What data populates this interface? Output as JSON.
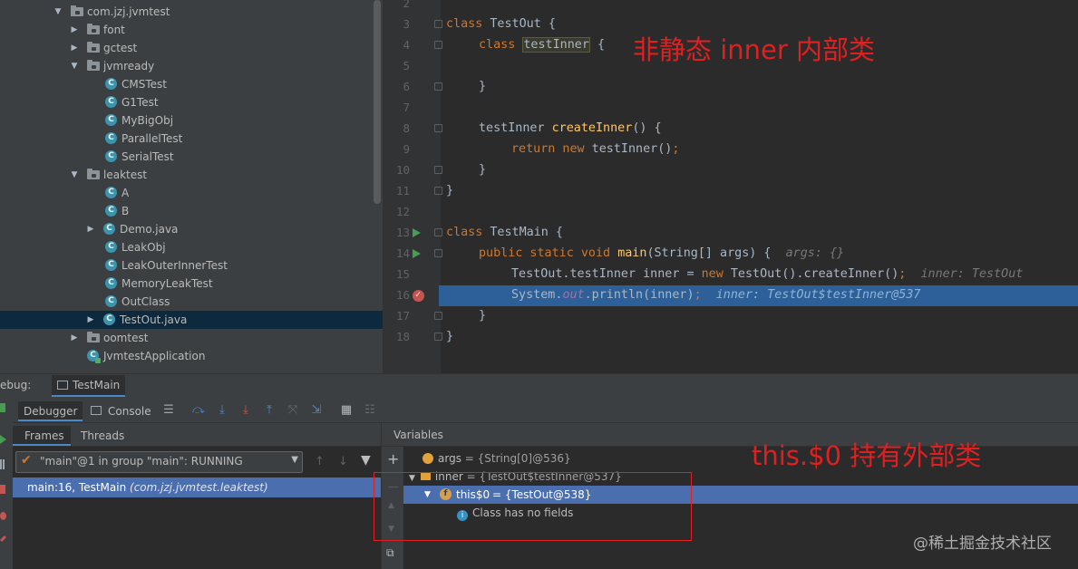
{
  "project_tree": {
    "items": [
      {
        "label": "com.jzj.jvmtest",
        "kind": "package",
        "expanded": true,
        "depth": 0
      },
      {
        "label": "font",
        "kind": "package",
        "expanded": false,
        "depth": 1
      },
      {
        "label": "gctest",
        "kind": "package",
        "expanded": false,
        "depth": 1
      },
      {
        "label": "jvmready",
        "kind": "package",
        "expanded": true,
        "depth": 1
      },
      {
        "label": "CMSTest",
        "kind": "class",
        "depth": 2
      },
      {
        "label": "G1Test",
        "kind": "class",
        "depth": 2
      },
      {
        "label": "MyBigObj",
        "kind": "class",
        "depth": 2
      },
      {
        "label": "ParallelTest",
        "kind": "class",
        "depth": 2
      },
      {
        "label": "SerialTest",
        "kind": "class",
        "depth": 2
      },
      {
        "label": "leaktest",
        "kind": "package",
        "expanded": true,
        "depth": 1
      },
      {
        "label": "A",
        "kind": "class",
        "depth": 2
      },
      {
        "label": "B",
        "kind": "class",
        "depth": 2
      },
      {
        "label": "Demo.java",
        "kind": "file",
        "depth": 2
      },
      {
        "label": "LeakObj",
        "kind": "class",
        "depth": 2
      },
      {
        "label": "LeakOuterInnerTest",
        "kind": "class",
        "depth": 2
      },
      {
        "label": "MemoryLeakTest",
        "kind": "class",
        "depth": 2
      },
      {
        "label": "OutClass",
        "kind": "class",
        "depth": 2
      },
      {
        "label": "TestOut.java",
        "kind": "file",
        "depth": 2,
        "selected": true
      },
      {
        "label": "oomtest",
        "kind": "package",
        "expanded": false,
        "depth": 1
      },
      {
        "label": "JvmtestApplication",
        "kind": "app",
        "depth": 1
      }
    ]
  },
  "editor": {
    "line_numbers": [
      "2",
      "3",
      "4",
      "5",
      "6",
      "7",
      "8",
      "9",
      "10",
      "11",
      "12",
      "13",
      "14",
      "15",
      "16",
      "17",
      "18"
    ],
    "code": {
      "l3_kw": "class",
      "l3_name": " TestOut {",
      "l4_kw": "class",
      "l4_name": "testInner",
      "l4_rest": " {",
      "l6": "}",
      "l8_type": "testInner ",
      "l8_fn": "createInner",
      "l8_rest": "() {",
      "l9_kw": "return new",
      "l9_rest": " testInner()",
      "l9_semi": ";",
      "l10": "}",
      "l11": "}",
      "l13_kw": "class",
      "l13_name": " TestMain {",
      "l14_kw": "public static void",
      "l14_fn": "main",
      "l14_rest": "(String[] args) {",
      "l14_hint": "args: {}",
      "l15_a": "TestOut.testInner inner = ",
      "l15_kw": "new",
      "l15_b": " TestOut().createInner()",
      "l15_semi": ";",
      "l15_hint": "inner: TestOut",
      "l16_a": "System.",
      "l16_out": "out",
      "l16_b": ".println(inner)",
      "l16_semi": ";",
      "l16_hint": "inner: TestOut$testInner@537",
      "l17": "}",
      "l18": "}"
    },
    "annotation": "非静态 inner 内部类"
  },
  "debug": {
    "title": "ebug:",
    "session_tab": "TestMain",
    "tabs": {
      "debugger": "Debugger",
      "console": "Console"
    },
    "frames_tab": "Frames",
    "threads_tab": "Threads",
    "thread_selected": "\"main\"@1 in group \"main\": RUNNING",
    "frame_method": "main:16, TestMain",
    "frame_package": "(com.jzj.jvmtest.leaktest)",
    "variables_header": "Variables",
    "variables": {
      "args_name": "args",
      "args_value": " = {String[0]@536}",
      "inner_name": "inner",
      "inner_value": " = {TestOut$testInner@537}",
      "this_name": "this$0",
      "this_value": " = {TestOut@538}",
      "no_fields": "Class has no fields"
    },
    "annotation": "this.$0 持有外部类"
  },
  "watermark": "@稀土掘金技术社区",
  "colors": {
    "accent": "#4b6eaf",
    "annotation_red": "#e02020",
    "breakpoint": "#c75450"
  }
}
